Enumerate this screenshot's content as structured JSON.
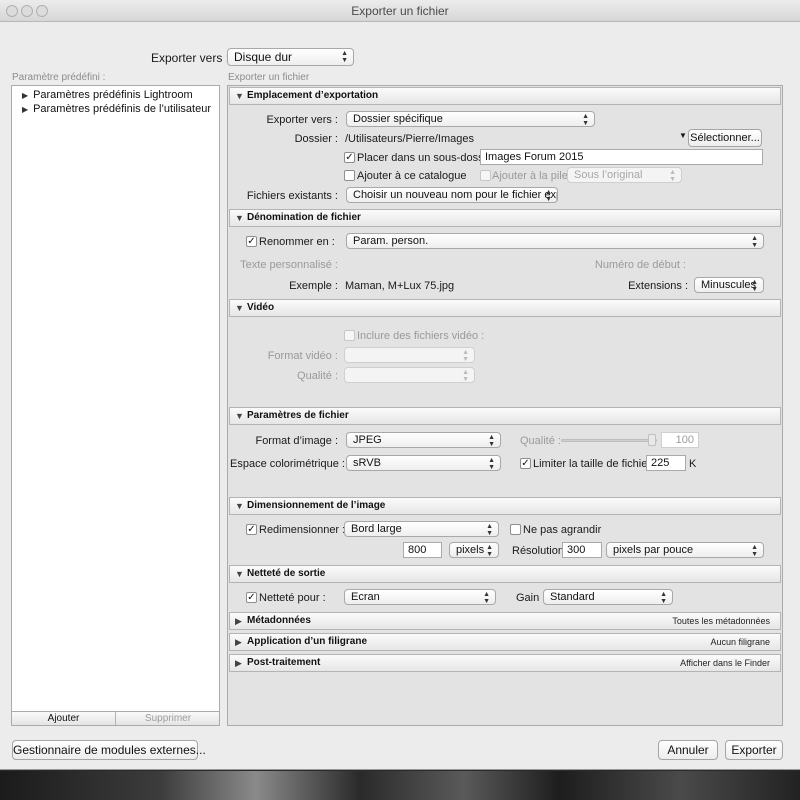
{
  "window": {
    "title": "Exporter un fichier"
  },
  "top": {
    "export_to_label": "Exporter vers :",
    "export_to_value": "Disque dur"
  },
  "left": {
    "header": "Paramètre prédéfini :",
    "items": [
      {
        "label": "Paramètres prédéfinis Lightroom"
      },
      {
        "label": "Paramètres prédéfinis de l’utilisateur"
      }
    ],
    "add_label": "Ajouter",
    "remove_label": "Supprimer"
  },
  "main": {
    "header": "Exporter un fichier"
  },
  "location": {
    "title": "Emplacement d’exportation",
    "export_to_label": "Exporter vers :",
    "export_to_value": "Dossier spécifique",
    "folder_label": "Dossier :",
    "folder_path": "/Utilisateurs/Pierre/Images",
    "choose_label": "Sélectionner...",
    "subfolder_label": "Placer dans un sous-dossier :",
    "subfolder_checked": true,
    "subfolder_value": "Images Forum 2015",
    "add_catalog_label": "Ajouter à ce catalogue",
    "add_catalog_checked": false,
    "add_stack_label": "Ajouter à la pile :",
    "stack_value": "Sous l’original",
    "existing_label": "Fichiers existants :",
    "existing_value": "Choisir un nouveau nom pour le fichier exporté"
  },
  "naming": {
    "title": "Dénomination de fichier",
    "rename_label": "Renommer en :",
    "rename_checked": true,
    "rename_value": "Param. person.",
    "custom_text_label": "Texte personnalisé :",
    "start_number_label": "Numéro de début :",
    "example_label": "Exemple :",
    "example_value": "Maman, M+Lux 75.jpg",
    "extensions_label": "Extensions :",
    "extensions_value": "Minuscules"
  },
  "video": {
    "title": "Vidéo",
    "include_label": "Inclure des fichiers vidéo :",
    "format_label": "Format vidéo :",
    "quality_label": "Qualité :"
  },
  "file_settings": {
    "title": "Paramètres de fichier",
    "format_label": "Format d’image :",
    "format_value": "JPEG",
    "quality_label": "Qualité :",
    "quality_value": "100",
    "colorspace_label": "Espace colorimétrique :",
    "colorspace_value": "sRVB",
    "limit_label": "Limiter la taille de fichier à :",
    "limit_checked": true,
    "limit_value": "225",
    "limit_unit": "K"
  },
  "sizing": {
    "title": "Dimensionnement de l’image",
    "resize_label": "Redimensionner :",
    "resize_checked": true,
    "resize_value": "Bord large",
    "no_enlarge_label": "Ne pas agrandir",
    "no_enlarge_checked": false,
    "size_value": "800",
    "size_unit": "pixels",
    "resolution_label": "Résolution :",
    "resolution_value": "300",
    "resolution_unit": "pixels par pouce"
  },
  "sharpening": {
    "title": "Netteté de sortie",
    "sharpen_label": "Netteté pour :",
    "sharpen_checked": true,
    "sharpen_value": "Ecran",
    "gain_label": "Gain :",
    "gain_value": "Standard"
  },
  "collapsed": [
    {
      "title": "Métadonnées",
      "summary": "Toutes les métadonnées"
    },
    {
      "title": "Application d’un filigrane",
      "summary": "Aucun filigrane"
    },
    {
      "title": "Post-traitement",
      "summary": "Afficher dans le Finder"
    }
  ],
  "bottom": {
    "plugin_manager_label": "Gestionnaire de modules externes...",
    "cancel_label": "Annuler",
    "export_label": "Exporter"
  },
  "glyphs": {
    "check": "✓",
    "collapsed": "▶",
    "expanded": "▼",
    "arrows_up": "▲",
    "arrows_down": "▼"
  }
}
